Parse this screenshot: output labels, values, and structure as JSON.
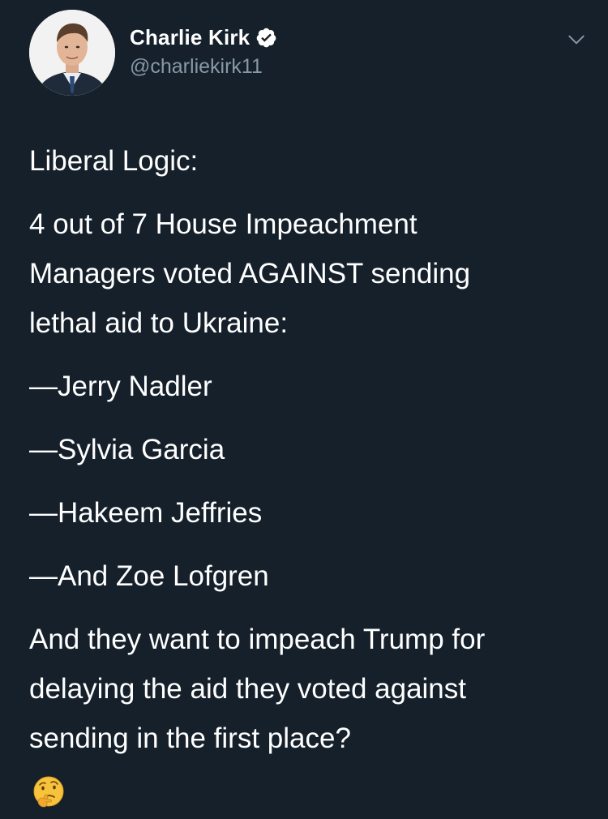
{
  "author": {
    "display_name": "Charlie Kirk",
    "handle": "@charliekirk11",
    "verified": true,
    "avatar": "profile-photo"
  },
  "header": {
    "menu_icon": "chevron-down-icon"
  },
  "tweet": {
    "lines": [
      "Liberal Logic:",
      "4 out of 7 House Impeachment",
      "Managers voted AGAINST sending",
      "lethal aid to Ukraine:",
      "—Jerry Nadler",
      "—Sylvia Garcia",
      "—Hakeem Jeffries",
      "—And Zoe Lofgren",
      "And they want to impeach Trump for",
      "delaying the aid they voted against",
      "sending in the first place?"
    ],
    "emoji": "thinking-face"
  },
  "colors": {
    "background": "#15202b",
    "text": "#ffffff",
    "secondary_text": "#8899a6",
    "verified_badge": "#ffffff"
  }
}
